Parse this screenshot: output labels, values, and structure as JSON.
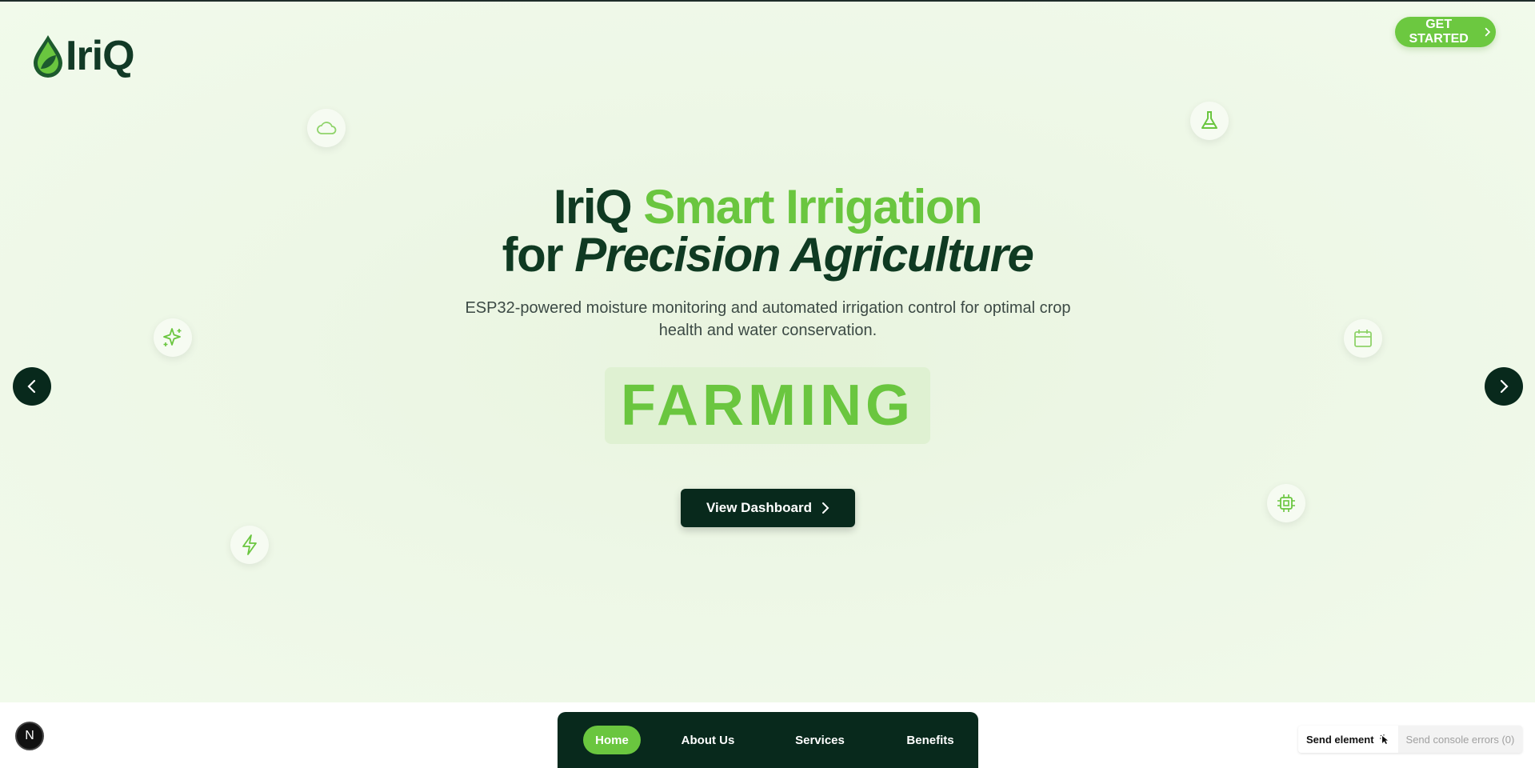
{
  "brand": {
    "name": "IriQ"
  },
  "header": {
    "cta_label": "GET STARTED"
  },
  "hero": {
    "title_part1": "IriQ ",
    "title_part2": "Smart Irrigation",
    "title_line2_part1": "for ",
    "title_line2_part2": "Precision Agriculture",
    "subtitle": "ESP32-powered moisture monitoring and automated irrigation control for optimal crop health and water conservation.",
    "rotating_word": "FARMING",
    "dashboard_label": "View Dashboard"
  },
  "floating_icons": [
    "cloud-icon",
    "flask-icon",
    "sparkles-icon",
    "calendar-icon",
    "zap-icon",
    "cpu-icon"
  ],
  "nav": {
    "items": [
      {
        "label": "Home",
        "active": true
      },
      {
        "label": "About Us",
        "active": false
      },
      {
        "label": "Services",
        "active": false
      },
      {
        "label": "Benefits",
        "active": false
      }
    ]
  },
  "devtools": {
    "badge": "N",
    "send_element": "Send element",
    "send_console_errors": "Send console errors (0)"
  },
  "colors": {
    "brand_green": "#6ac63f",
    "dark_green": "#08291c",
    "hero_bg": "#edf7e6"
  }
}
